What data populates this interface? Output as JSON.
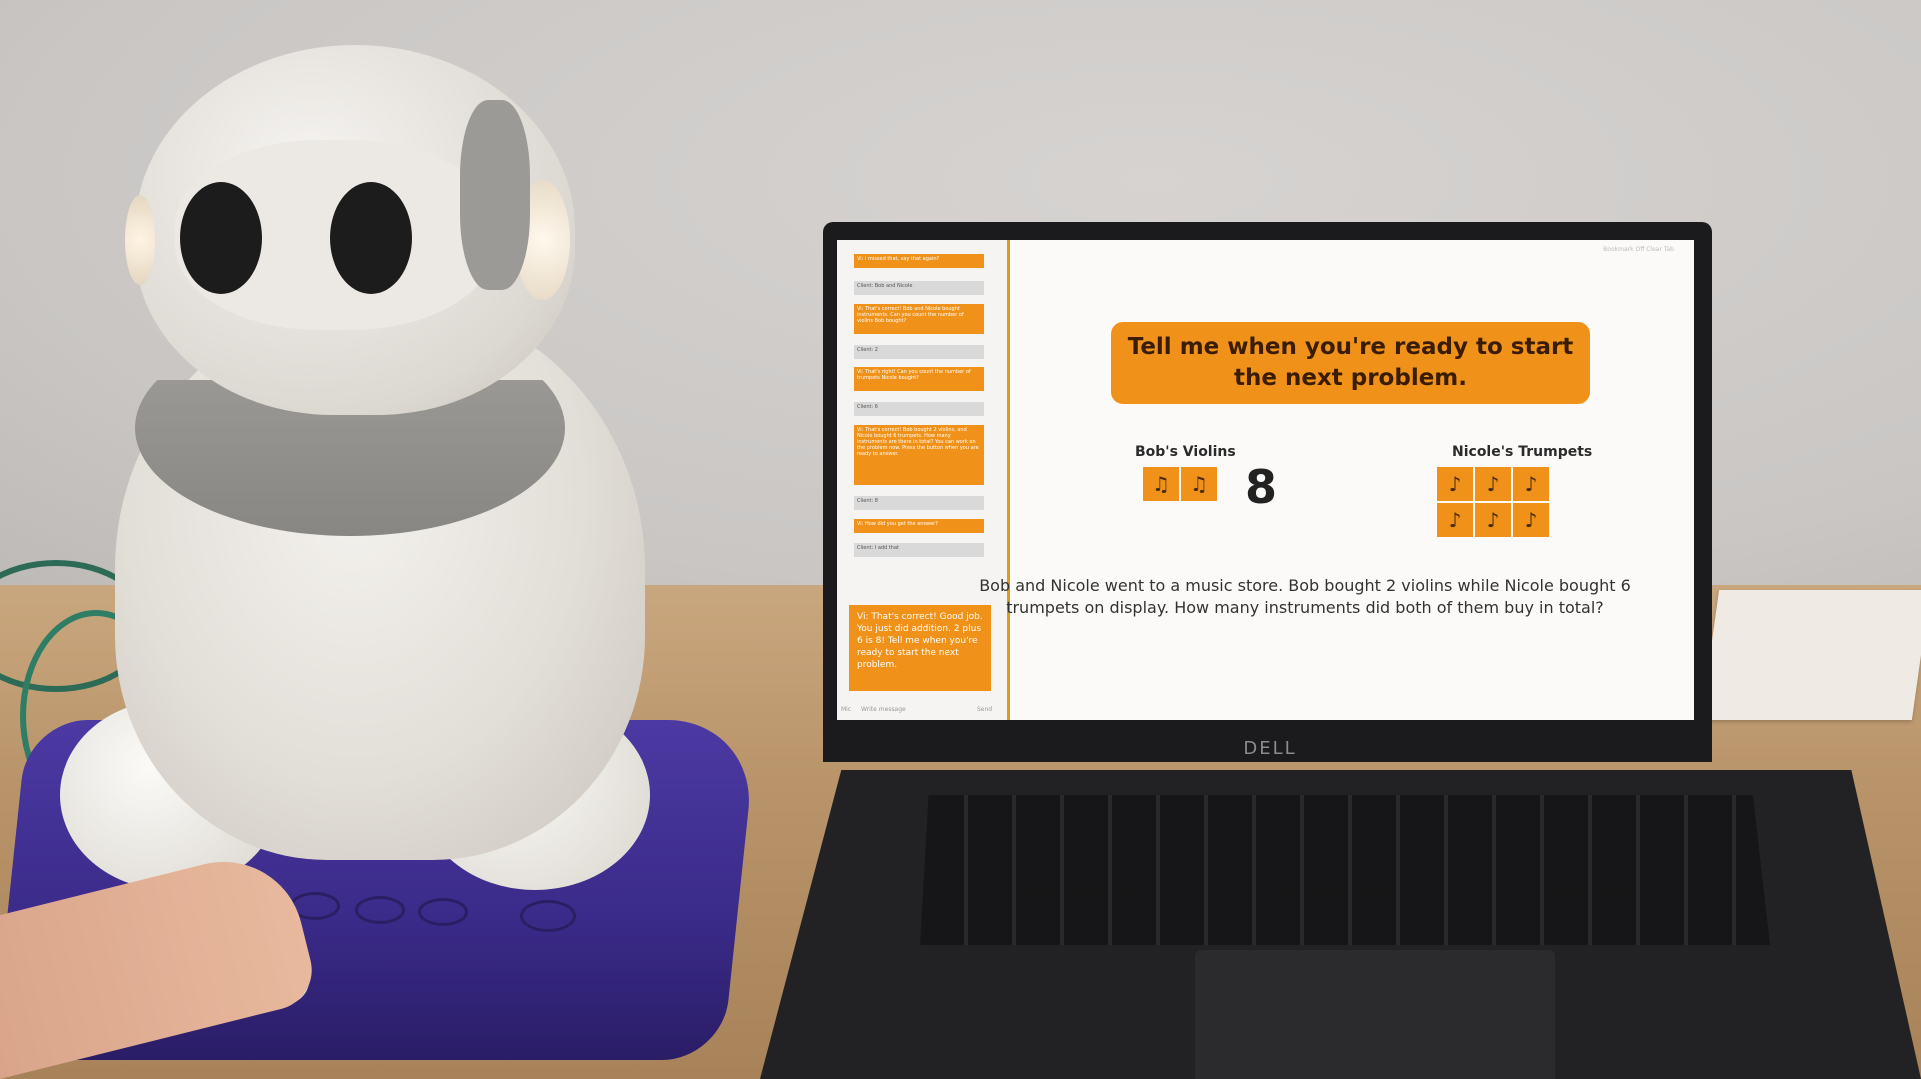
{
  "laptop": {
    "brand": "DELL",
    "screen": {
      "top_right_text": "Bookmark Off  Clear Tab",
      "banner": "Tell me when you're ready to start the next problem.",
      "left_group_title": "Bob's Violins",
      "right_group_title": "Nicole's Trumpets",
      "left_icon": "violin-icon",
      "right_icon": "trumpet-icon",
      "left_count": 2,
      "right_count": 6,
      "total": "8",
      "problem_text": "Bob and Nicole went to a music store. Bob bought 2 violins while Nicole bought 6 trumpets on display. How many instruments did both of them buy in total?",
      "chat": {
        "messages": [
          {
            "role": "robot",
            "text": "Vi: I missed that, say that again?"
          },
          {
            "role": "client",
            "text": "Client: Bob and Nicole"
          },
          {
            "role": "robot",
            "text": "Vi: That's correct! Bob and Nicole bought instruments. Can you count the number of violins Bob bought?"
          },
          {
            "role": "client",
            "text": "Client: 2"
          },
          {
            "role": "robot",
            "text": "Vi: That's right! Can you count the number of trumpets Nicole bought?"
          },
          {
            "role": "client",
            "text": "Client: 6"
          },
          {
            "role": "robot",
            "text": "Vi: That's correct! Bob bought 2 violins, and Nicole bought 6 trumpets. How many instruments are there in total? You can work on the problem now. Press the button when you are ready to answer."
          },
          {
            "role": "client",
            "text": "Client: 8"
          },
          {
            "role": "robot",
            "text": "Vi: How did you get the answer?"
          },
          {
            "role": "client",
            "text": "Client: I add that"
          }
        ],
        "latest": "Vi: That's correct! Good job. You just did addition. 2 plus 6 is 8! Tell me when you're ready to start the next problem.",
        "input_placeholder": "Write message",
        "send_label": "Send",
        "mic_label": "Mic"
      }
    }
  },
  "colors": {
    "accent": "#f0921a",
    "robot_base": "#3a2a88"
  }
}
